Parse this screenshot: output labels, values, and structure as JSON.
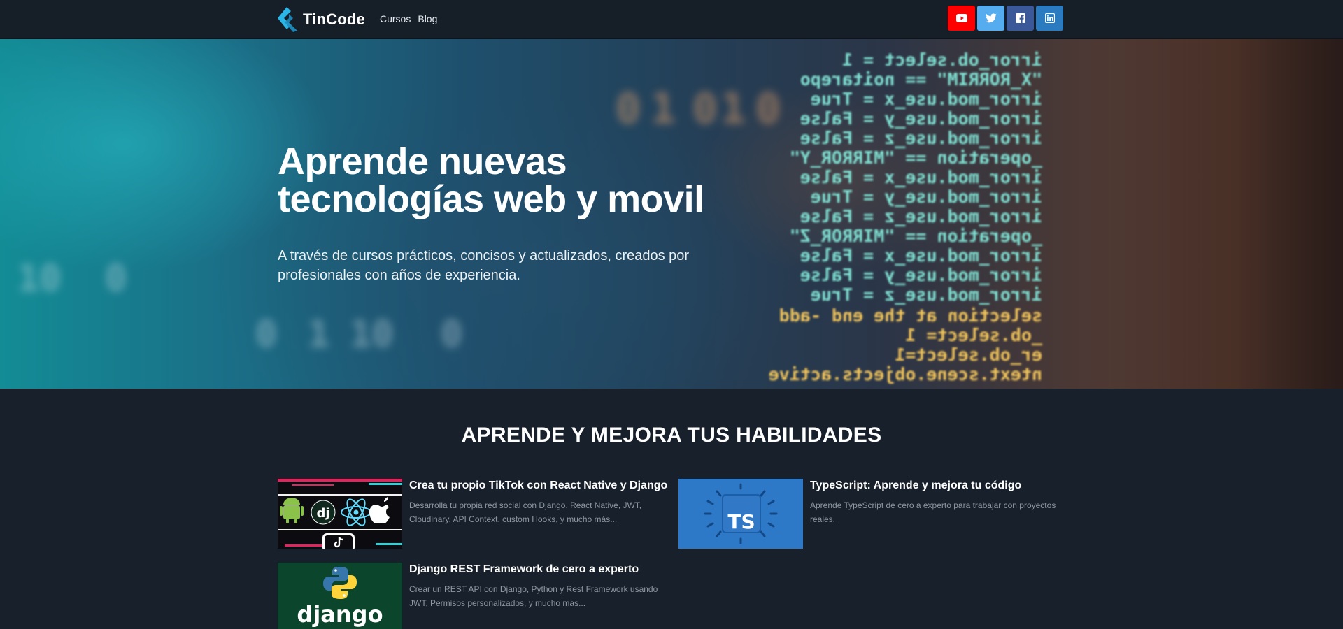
{
  "header": {
    "brand_name": "TinCode",
    "nav": [
      {
        "label": "Cursos"
      },
      {
        "label": "Blog"
      }
    ],
    "social": [
      {
        "icon": "youtube-icon",
        "color": "#ff0000"
      },
      {
        "icon": "twitter-icon",
        "color": "#55acee"
      },
      {
        "icon": "facebook-icon",
        "color": "#3b5998"
      },
      {
        "icon": "linkedin-icon",
        "color": "#2a7bbf"
      }
    ]
  },
  "hero": {
    "title_line1": "Aprende nuevas",
    "title_line2": "tecnologías web y movil",
    "subtitle": "A través de cursos prácticos, concisos y actualizados, creados por profesionales con años de experiencia."
  },
  "section": {
    "title": "APRENDE Y MEJORA TUS HABILIDADES",
    "courses": [
      {
        "title": "Crea tu propio TikTok con React Native y Django",
        "description": "Desarrolla tu propia red social con Django, React Native, JWT, Cloudinary, API Context, custom Hooks, y mucho más...",
        "thumb_text": "dj"
      },
      {
        "title": "TypeScript: Aprende y mejora tu código",
        "description": "Aprende TypeScript de cero a experto para trabajar con proyectos reales.",
        "thumb_text": "TS"
      },
      {
        "title": "Django REST Framework de cero a experto",
        "description": "Crear un REST API con Django, Python y Rest Framework usando JWT, Permisos personalizados, y mucho mas...",
        "thumb_text": "django"
      }
    ]
  },
  "colors": {
    "page_bg": "#18202b",
    "header_bg": "#161e28",
    "brand_accent": "#2bb6e8"
  }
}
